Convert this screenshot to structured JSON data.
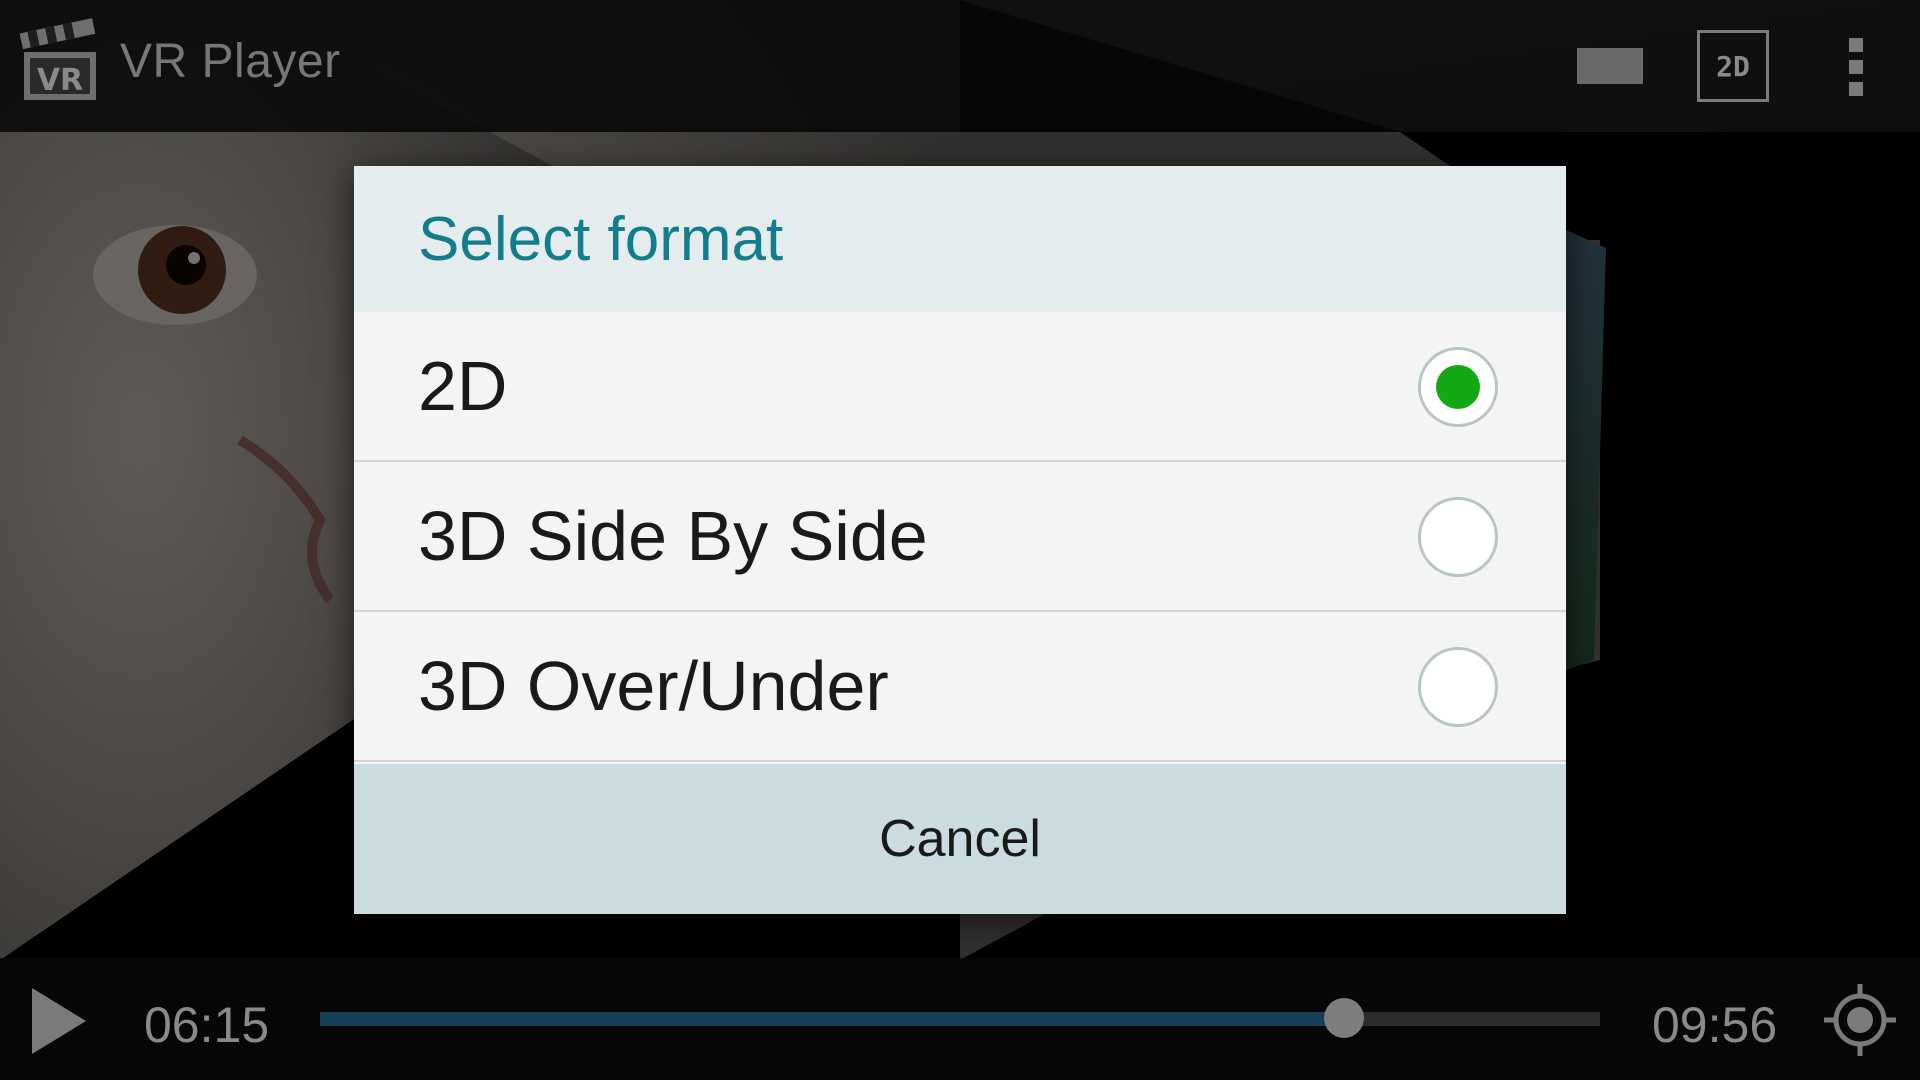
{
  "app": {
    "title": "VR Player",
    "logo_text": "VR"
  },
  "actionbar": {
    "format_button_label": "2D",
    "icons": [
      "vr-clapperboard-logo-icon",
      "screen-mode-icon",
      "format-2d-icon",
      "overflow-menu-icon"
    ]
  },
  "dialog": {
    "title": "Select format",
    "options": [
      {
        "label": "2D",
        "selected": true
      },
      {
        "label": "3D Side By Side",
        "selected": false
      },
      {
        "label": "3D Over/Under",
        "selected": false
      }
    ],
    "cancel_label": "Cancel"
  },
  "player": {
    "current_time": "06:15",
    "total_time": "09:56",
    "progress_fraction": 0.8,
    "icons": [
      "play-icon",
      "recenter-target-icon"
    ]
  },
  "colors": {
    "accent_title": "#147d8c",
    "radio_checked": "#15a815",
    "dialog_header_bg": "#e5eced",
    "cancel_bg": "#cadcdf",
    "seek_progress": "#153e57"
  }
}
